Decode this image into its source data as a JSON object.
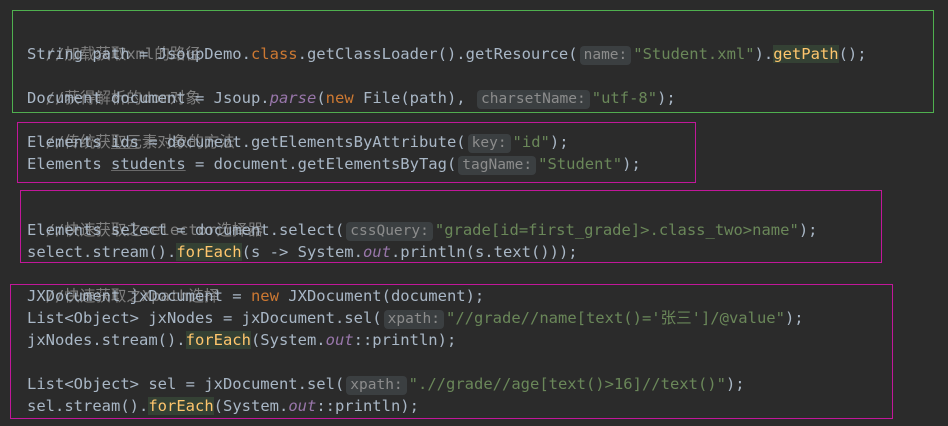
{
  "colors": {
    "background": "#2b2b2b",
    "comment": "#808080",
    "keyword": "#cc7832",
    "string": "#6a8759",
    "static_member": "#9876aa",
    "green_box": "#4fb04f",
    "pink_box": "#c2179a"
  },
  "code": {
    "l1": {
      "comment": "//加载获取xml的路径"
    },
    "l2": {
      "a": "String path = JsoupDemo.",
      "kw": "class",
      "b": ".getClassLoader().getResource(",
      "hint": "name:",
      "str": "\"Student.xml\"",
      "c": ").",
      "hl": "getPath",
      "d": "();"
    },
    "l3": {
      "comment": "//获得解析的dom对象"
    },
    "l4": {
      "a": "Document document = Jsoup.",
      "it": "parse",
      "b": "(",
      "kw": "new",
      "c": " File(path), ",
      "hint": "charsetName:",
      "str": "\"utf-8\"",
      "d": ");"
    },
    "l5": {
      "comment": "//传统获取元素对象的方法"
    },
    "l6": {
      "a": "Elements ",
      "field": "ids",
      "b": " = document.getElementsByAttribute(",
      "hint": "key:",
      "str": "\"id\"",
      "c": ");"
    },
    "l7": {
      "a": "Elements ",
      "field": "students",
      "b": " = document.getElementsByTag(",
      "hint": "tagName:",
      "str": "\"Student\"",
      "c": ");"
    },
    "l8": {
      "comment": "//快速获取之selector选择器"
    },
    "l9": {
      "a": "Elements select = document.select(",
      "hint": "cssQuery:",
      "str": "\"grade[id=first_grade]>.class_two>name\"",
      "b": ");"
    },
    "l10": {
      "a": "select.stream().",
      "hl": "forEach",
      "b": "(s -> System.",
      "it": "out",
      "c": ".println(s.text()));"
    },
    "l11": {
      "comment": "//快速获取之Xpath选择"
    },
    "l12": {
      "a": "JXDocument jxDocument = ",
      "kw": "new",
      "b": " JXDocument(document);"
    },
    "l13": {
      "a": "List<Object> jxNodes = jxDocument.sel(",
      "hint": "xpath:",
      "str": "\"//grade//name[text()='张三']/@value\"",
      "b": ");"
    },
    "l14": {
      "a": "jxNodes.stream().",
      "hl": "forEach",
      "b": "(System.",
      "it": "out",
      "c": "::println);"
    },
    "l15": {
      "a": "List<Object> sel = jxDocument.sel(",
      "hint": "xpath:",
      "str": "\".//grade//age[text()>16]//text()\"",
      "b": ");"
    },
    "l16": {
      "a": "sel.stream().",
      "hl": "forEach",
      "b": "(System.",
      "it": "out",
      "c": "::println);"
    }
  }
}
